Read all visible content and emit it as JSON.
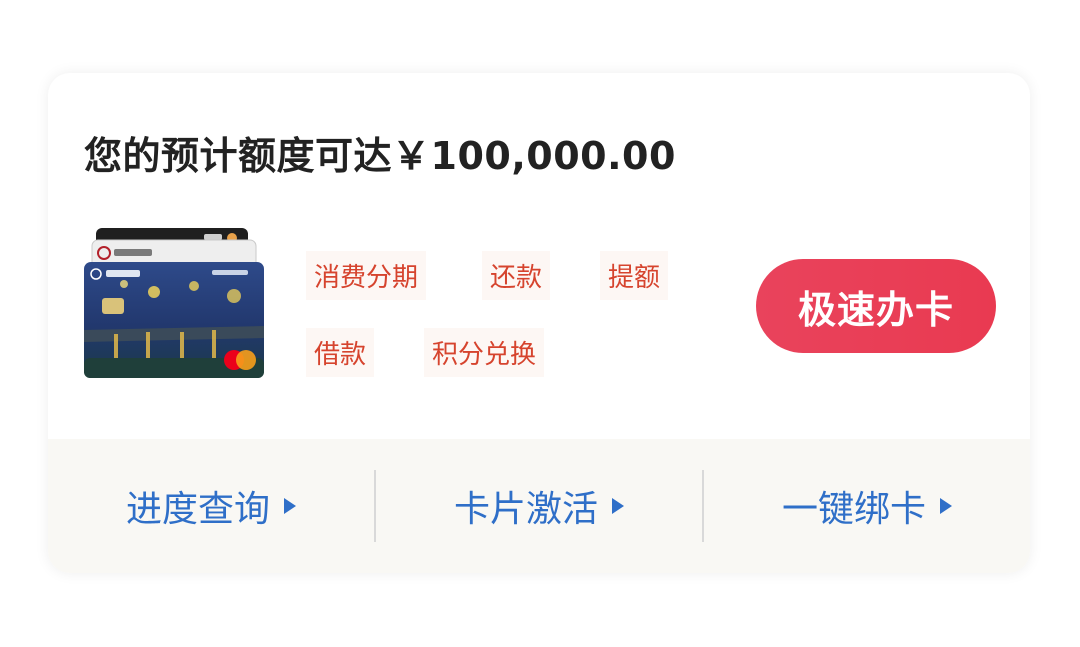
{
  "offer": {
    "title": "您的预计额度可达￥100,000.00"
  },
  "features": [
    {
      "label": "消费分期"
    },
    {
      "label": "还款"
    },
    {
      "label": "提额"
    },
    {
      "label": "借款"
    },
    {
      "label": "积分兑换"
    }
  ],
  "apply_button": {
    "label": "极速办卡"
  },
  "actions": [
    {
      "label": "进度查询"
    },
    {
      "label": "卡片激活"
    },
    {
      "label": "一键绑卡"
    }
  ],
  "colors": {
    "accent_red": "#e93f56",
    "feature_text": "#d6442e",
    "link_blue": "#2f6fc8",
    "title_text": "#222222"
  },
  "icons": [
    "credit-card-stack-image",
    "mastercard-logo",
    "chevron-right-icon"
  ]
}
